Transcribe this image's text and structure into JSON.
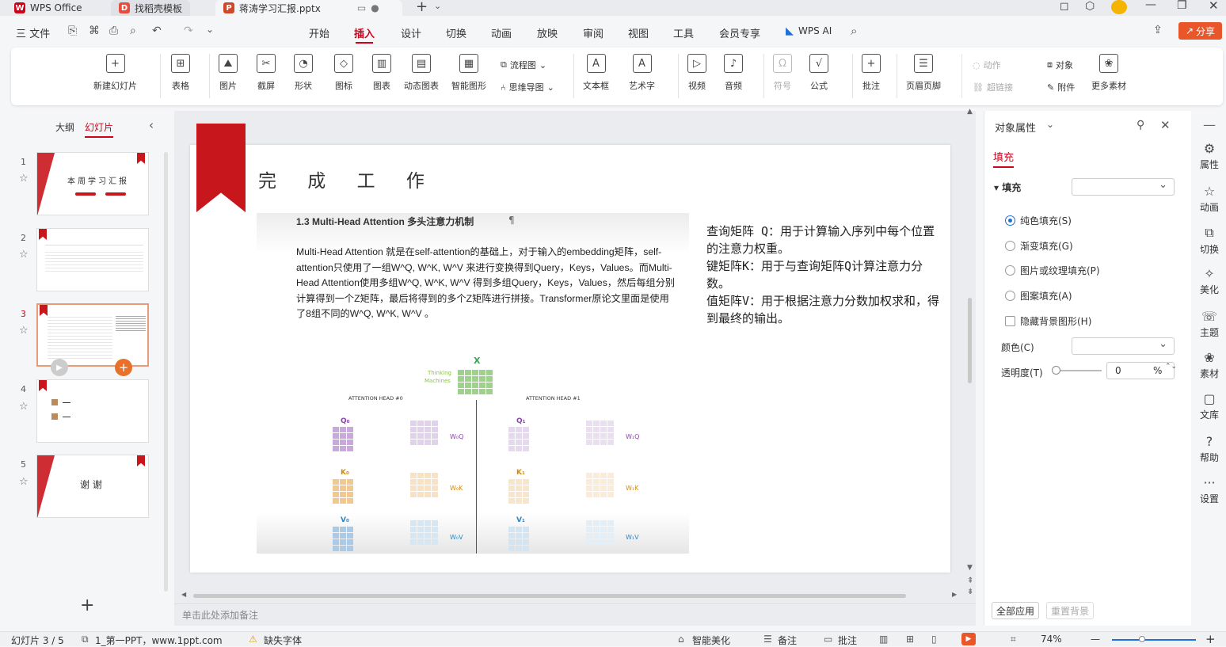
{
  "tabs": [
    {
      "label": "WPS Office",
      "icon": "wps-logo-icon"
    },
    {
      "label": "找稻壳模板",
      "icon": "docer-icon"
    },
    {
      "label": "蒋涛学习汇报.pptx",
      "icon": "pptx-icon"
    }
  ],
  "menu": {
    "file": "三 文件",
    "items": [
      "开始",
      "插入",
      "设计",
      "切换",
      "动画",
      "放映",
      "审阅",
      "视图",
      "工具",
      "会员专享"
    ],
    "active": "插入",
    "ai": "WPS AI",
    "share": "分享"
  },
  "ribbon": {
    "new_slide": "新建幻灯片",
    "table": "表格",
    "picture": "图片",
    "screenshot": "截屏",
    "shape": "形状",
    "icon": "图标",
    "chart": "图表",
    "dynamic_chart": "动态图表",
    "smart_graphic": "智能图形",
    "flowchart": "流程图",
    "mindmap": "思维导图",
    "textbox": "文本框",
    "wordart": "艺术字",
    "video": "视频",
    "audio": "音频",
    "symbol": "符号",
    "formula": "公式",
    "comment": "批注",
    "header_footer": "页眉页脚",
    "action": "动作",
    "hyperlink": "超链接",
    "object": "对象",
    "attachment": "附件",
    "more": "更多素材"
  },
  "left_panel": {
    "tab_outline": "大纲",
    "tab_slides": "幻灯片",
    "slides": [
      {
        "num": "1",
        "title": "本周学习汇报"
      },
      {
        "num": "2",
        "title": ""
      },
      {
        "num": "3",
        "title": ""
      },
      {
        "num": "4",
        "title": ""
      },
      {
        "num": "5",
        "title": "谢 谢"
      }
    ],
    "add": "+"
  },
  "slide": {
    "heading": "完 成 工 作",
    "section_title": "1.3 Multi-Head Attention 多头注意力机制",
    "para_mark": "¶",
    "body": "Multi-Head Attention 就是在self-attention的基础上，对于输入的embedding矩阵，self-attention只使用了一组W^Q, W^K, W^V 来进行变换得到Query，Keys，Values。而Multi-Head Attention使用多组W^Q, W^K, W^V 得到多组Query，Keys，Values，然后每组分别计算得到一个Z矩阵，最后将得到的多个Z矩阵进行拼接。Transformer原论文里面是使用了8组不同的W^Q, W^K, W^V 。",
    "right_text_1": "查询矩阵 Q：用于计算输入序列中每个位置的注意力权重。",
    "right_text_2": "键矩阵K：用于与查询矩阵Q计算注意力分数。",
    "right_text_3": "值矩阵V：用于根据注意力分数加权求和，得到最终的输出。",
    "figure": {
      "x_label": "X",
      "thinking": "Thinking",
      "machines": "Machines",
      "head0": "ATTENTION HEAD #0",
      "head1": "ATTENTION HEAD #1",
      "q0": "Q₀",
      "k0": "K₀",
      "v0": "V₀",
      "wq0": "W₀Q",
      "wk0": "W₀K",
      "wv0": "W₀V",
      "q1": "Q₁",
      "k1": "K₁",
      "v1": "V₁",
      "wq1": "W₁Q",
      "wk1": "W₁K",
      "wv1": "W₁V"
    }
  },
  "notes_placeholder": "单击此处添加备注",
  "right_panel": {
    "title": "对象属性",
    "tab_fill": "填充",
    "fill_section": "填充",
    "options": [
      "纯色填充(S)",
      "渐变填充(G)",
      "图片或纹理填充(P)",
      "图案填充(A)"
    ],
    "selected_option": "纯色填充(S)",
    "hide_bg": "隐藏背景图形(H)",
    "color_label": "颜色(C)",
    "transparency_label": "透明度(T)",
    "transparency_value": "0",
    "transparency_unit": "%",
    "apply_all": "全部应用",
    "reset_bg": "重置背景"
  },
  "sidebar": [
    "属性",
    "动画",
    "切换",
    "美化",
    "主题",
    "素材",
    "文库",
    "帮助",
    "设置"
  ],
  "status": {
    "slide_info": "幻灯片 3 / 5",
    "theme": "1_第一PPT，www.1ppt.com",
    "missing_font": "缺失字体",
    "beautify": "智能美化",
    "notes": "备注",
    "comments": "批注",
    "zoom": "74%"
  },
  "colors": {
    "accent": "#c8161d",
    "wps_red": "#d0021b"
  }
}
